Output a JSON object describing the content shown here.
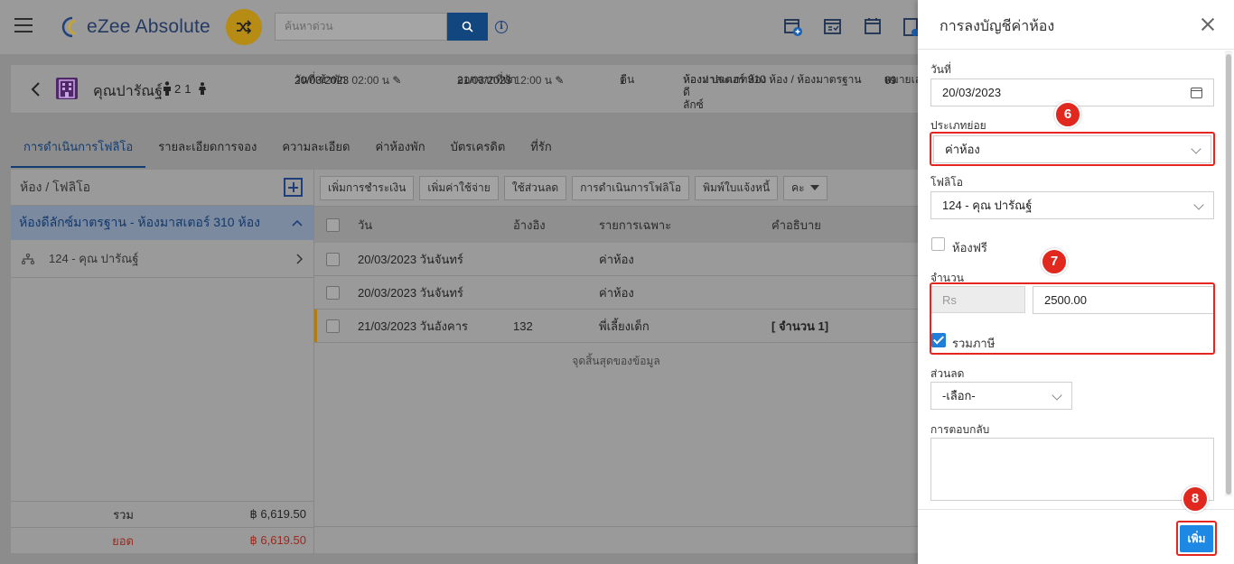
{
  "app": {
    "logo_text": "eZee Absolute",
    "search_placeholder": "ค้นหาด่วน"
  },
  "guest": {
    "name": "คุณปารัณฐ์",
    "adults": "2",
    "children": "1",
    "checkin_label": "วันที่เข้าพัก",
    "checkin_date": "20/03/2023",
    "checkin_time": "02:00 น",
    "checkout_label": "ออกจากที่พัก",
    "checkout_date": "21/03/2023",
    "checkout_time": "12:00 น",
    "nights_label": "คืน",
    "nights": "1",
    "room_label": "ห้อง / ประเภทห้อง",
    "room_value_1": "ห้องมาสเตอร์ 310 ห้อง / ห้องมาตรฐานดี",
    "room_value_2": "ลักซ์",
    "number_label": "หมายเล",
    "number_value": "69"
  },
  "tabs": [
    "การดำเนินการโฟลิโอ",
    "รายละเอียดการจอง",
    "ความละเอียด",
    "ค่าห้องพัก",
    "บัตรเครดิต",
    "ที่รัก"
  ],
  "left_panel": {
    "header": "ห้อง / โฟลิโอ",
    "group": "ห้องดีลักซ์มาตรฐาน - ห้องมาสเตอร์ 310 ห้อง",
    "item": "124 - คุณ ปารัณฐ์",
    "total_label": "รวม",
    "total_value": "฿ 6,619.50",
    "balance_label": "ยอด",
    "balance_value": "฿ 6,619.50"
  },
  "toolbar": {
    "add_payment": "เพิ่มการชำระเงิน",
    "add_expense": "เพิ่มค่าใช้จ่าย",
    "discount": "ใช้ส่วนลด",
    "folio_ops": "การดำเนินการโฟลิโอ",
    "print_invoice": "พิมพ์ใบแจ้งหนี้",
    "more": "คะ"
  },
  "table": {
    "headers": {
      "date": "วัน",
      "ref": "อ้างอิง",
      "detail": "รายการเฉพาะ",
      "desc": "คำอธิบาย"
    },
    "rows": [
      {
        "date": "20/03/2023 วันจันทร์",
        "ref": "",
        "detail": "ค่าห้อง",
        "desc": ""
      },
      {
        "date": "20/03/2023 วันจันทร์",
        "ref": "",
        "detail": "ค่าห้อง",
        "desc": ""
      },
      {
        "date": "21/03/2023 วันอังคาร",
        "ref": "132",
        "detail": "พี่เลี้ยงเด็ก",
        "desc": "[ จำนวน 1]"
      }
    ],
    "end_text": "จุดสิ้นสุดของข้อมูล"
  },
  "drawer": {
    "title": "การลงบัญชีค่าห้อง",
    "date_label": "วันที่",
    "date_value": "20/03/2023",
    "subtype_label": "ประเภทย่อย",
    "subtype_value": "ค่าห้อง",
    "folio_label": "โฟลิโอ",
    "folio_value": "124 - คุณ ปารัณฐ์",
    "free_room_label": "ห้องฟรี",
    "amount_label": "จำนวน",
    "currency": "Rs",
    "amount_value": "2500.00",
    "tax_inclusive_label": "รวมภาษี",
    "discount_label": "ส่วนลด",
    "discount_value": "-เลือก-",
    "remark_label": "การตอบกลับ",
    "add_button": "เพิ่ม"
  },
  "callouts": [
    "6",
    "7",
    "8"
  ],
  "colors": {
    "brand_blue": "#1e88e5",
    "callout_red": "#e0281f",
    "shuffle": "#b68c14"
  }
}
